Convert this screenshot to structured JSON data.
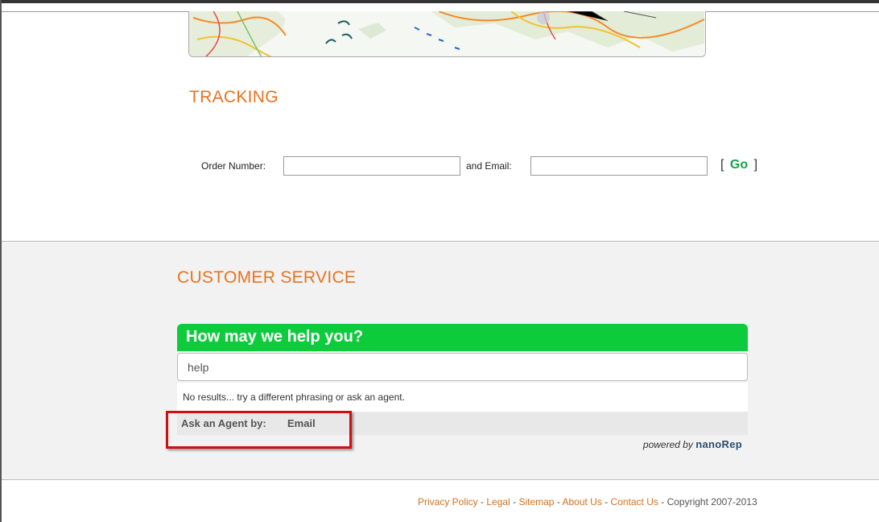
{
  "tracking": {
    "title": "TRACKING",
    "order_label": "Order Number:",
    "order_value": "",
    "email_label": "and Email:",
    "email_value": "",
    "go_bracket_open": "[",
    "go_label": "Go",
    "go_bracket_close": "]"
  },
  "customer_service": {
    "title": "CUSTOMER SERVICE",
    "widget": {
      "header": "How may we help you?",
      "search_value": "help",
      "no_results": "No results... try a different phrasing or ask an agent.",
      "ask_agent_label": "Ask an Agent by:",
      "ask_agent_email": "Email",
      "powered_by": "powered by",
      "brand": "nanoRep"
    }
  },
  "footer": {
    "links": [
      "Privacy Policy",
      "Legal",
      "Sitemap",
      "About Us",
      "Contact Us"
    ],
    "separator": "-",
    "copyright": "Copyright 2007-2013"
  },
  "colors": {
    "heading_orange": "#e8731f",
    "widget_green": "#0ccc3c",
    "go_green": "#11a34a",
    "link_orange": "#d2721c",
    "highlight_red": "#d01010"
  },
  "icons": {
    "map": "uk-map-image"
  }
}
